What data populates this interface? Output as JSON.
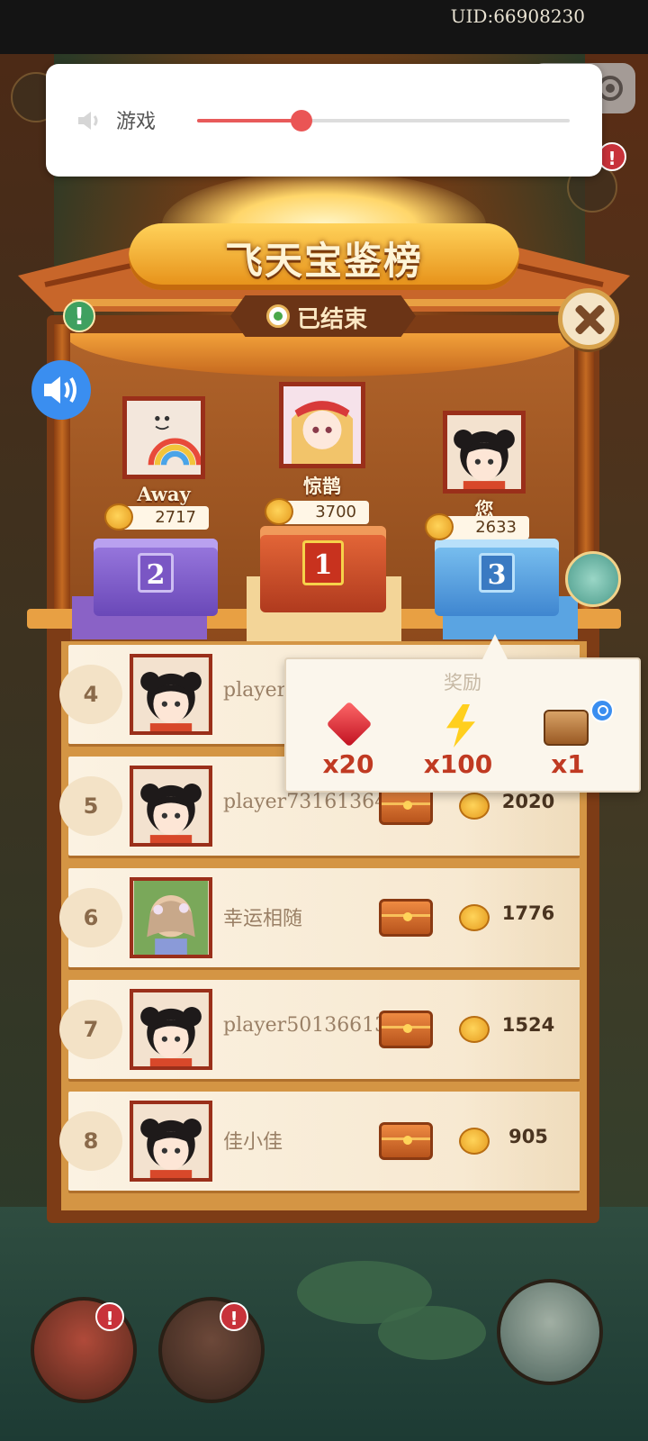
{
  "status_bar": {
    "uid": "UID:66908230"
  },
  "volume": {
    "label": "游戏",
    "level": 0.28,
    "accent": "#ea5555"
  },
  "leaderboard": {
    "title": "飞天宝鉴榜",
    "status": "已结束",
    "podium": [
      {
        "rank": "2",
        "name": "Away",
        "score": "2717"
      },
      {
        "rank": "1",
        "name": "惊鹊",
        "score": "3700"
      },
      {
        "rank": "3",
        "name": "您",
        "score": "2633"
      }
    ],
    "rows": [
      {
        "rank": "4",
        "name": "player",
        "score": ""
      },
      {
        "rank": "5",
        "name": "player73161364",
        "score": "2020"
      },
      {
        "rank": "6",
        "name": "幸运相随",
        "score": "1776"
      },
      {
        "rank": "7",
        "name": "player50136613",
        "score": "1524"
      },
      {
        "rank": "8",
        "name": "佳小佳",
        "score": "905"
      }
    ]
  },
  "reward_popup": {
    "title": "奖励",
    "items": [
      {
        "icon": "ruby-gem-icon",
        "qty": "x20"
      },
      {
        "icon": "lightning-energy-icon",
        "qty": "x100"
      },
      {
        "icon": "treasure-chest-icon",
        "qty": "x1"
      }
    ]
  },
  "badges": {
    "top_right": "!",
    "bottom_left": "!",
    "bottom_mid": "!"
  },
  "colors": {
    "frame": "#7d3c16",
    "gold": "#ffd25a",
    "rank_2": "#8a62c6",
    "rank_1": "#e86a3a",
    "rank_3": "#5aa4e2"
  }
}
